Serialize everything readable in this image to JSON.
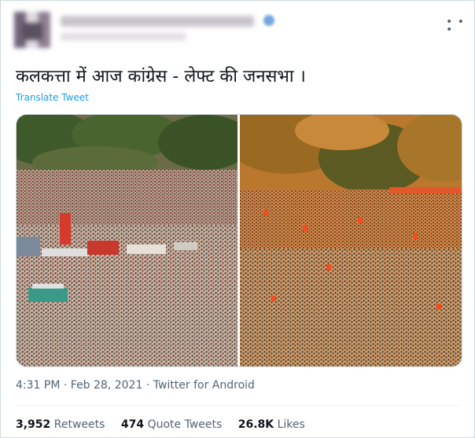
{
  "tweet": {
    "more_icon": "more-dots-icon",
    "text": "कलकत्ता में आज कांग्रेस - लेफ्ट की जनसभा ।",
    "translate_label": "Translate Tweet",
    "time": "4:31 PM",
    "date": "Feb 28, 2021",
    "source": "Twitter for Android",
    "separator": " · "
  },
  "stats": {
    "retweets_count": "3,952",
    "retweets_label": "Retweets",
    "quotes_count": "474",
    "quotes_label": "Quote Tweets",
    "likes_count": "26.8K",
    "likes_label": "Likes"
  },
  "colors": {
    "link": "#1d9bf0",
    "secondary_text": "#536471",
    "border": "#cfd9de"
  }
}
